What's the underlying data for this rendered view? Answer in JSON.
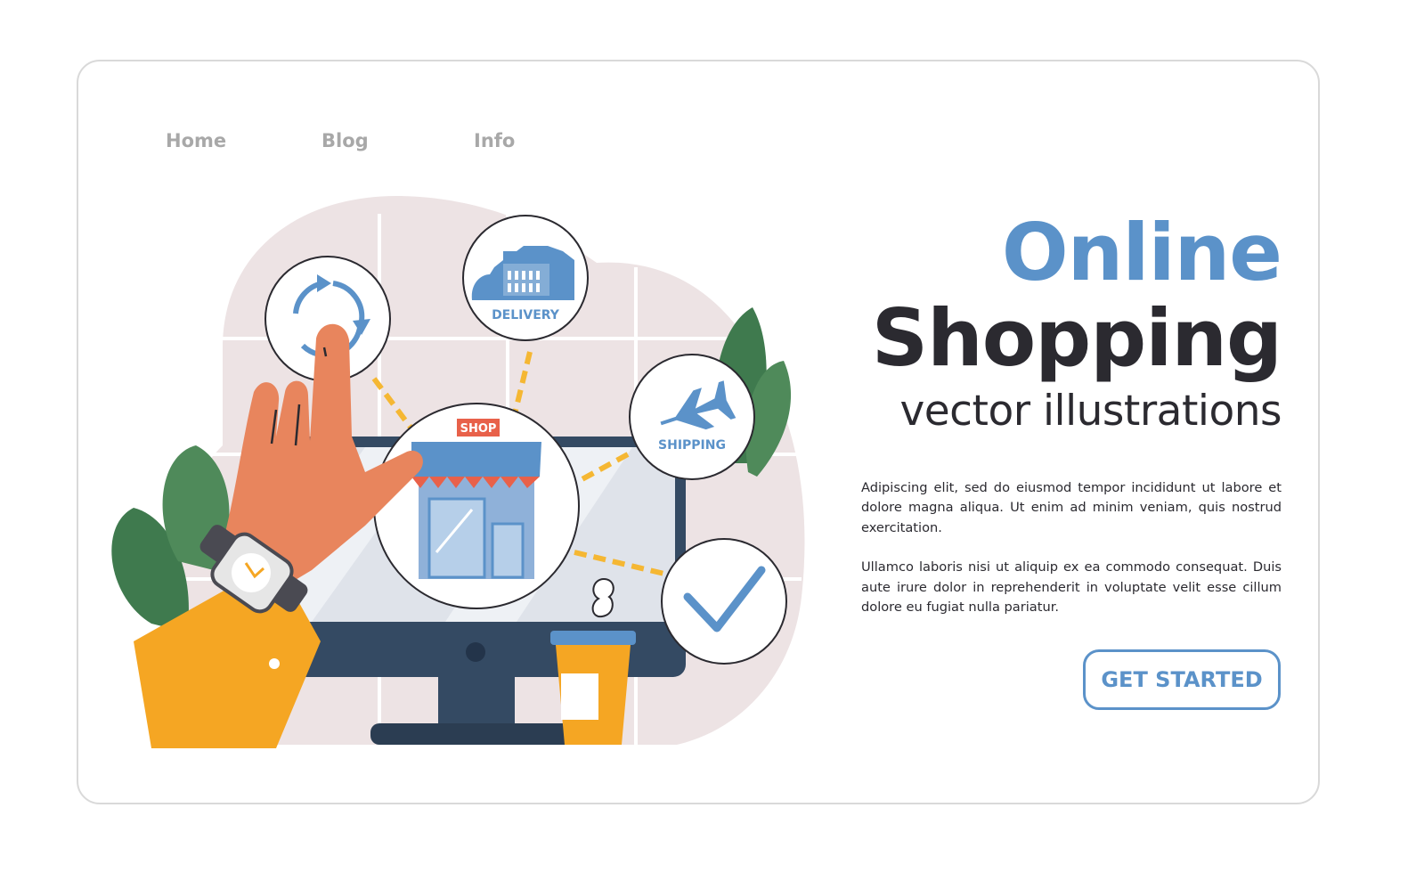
{
  "nav": {
    "items": [
      {
        "label": "Home"
      },
      {
        "label": "Blog"
      },
      {
        "label": "Info"
      }
    ]
  },
  "hero": {
    "title_line1": "Online",
    "title_line2": "Shopping",
    "subtitle": "vector illustrations",
    "paragraphs": [
      "Adipiscing elit, sed do eiusmod tempor incididunt ut labore et dolore magna aliqua. Ut enim ad minim veniam, quis nostrud exercitation.",
      "Ullamco laboris nisi ut aliquip ex ea commodo consequat. Duis aute irure dolor in reprehenderit in voluptate velit esse cillum dolore eu fugiat nulla pariatur."
    ],
    "cta_label": "GET STARTED"
  },
  "illustration": {
    "shop_sign": "SHOP",
    "delivery_label": "DELIVERY",
    "shipping_label": "SHIPPING",
    "icons": [
      "refresh-icon",
      "delivery-warehouse-icon",
      "shipping-plane-icon",
      "shop-store-icon",
      "checkmark-icon",
      "wristwatch-icon",
      "coffee-cup-icon"
    ]
  },
  "colors": {
    "accent_blue": "#5b92c9",
    "dark_text": "#2b2a30",
    "nav_gray": "#a8a8a8",
    "blob_pink": "#ede3e4",
    "leaf_green": "#4f8a5a",
    "skin": "#e8855d",
    "sleeve_yellow": "#f5a623",
    "monitor_dark": "#344a63"
  }
}
